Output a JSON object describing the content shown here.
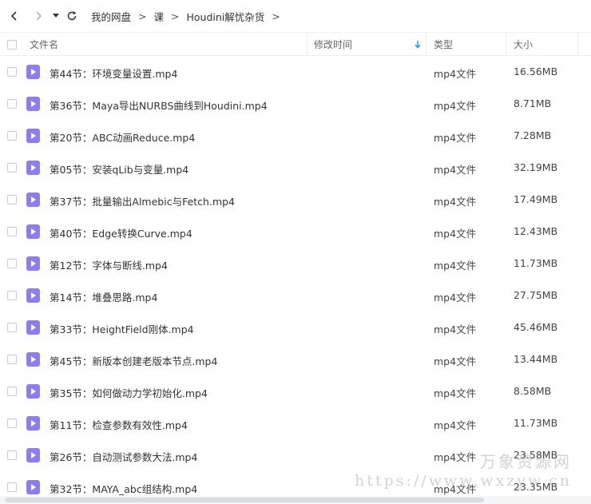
{
  "breadcrumb": [
    "我的网盘",
    "课",
    "Houdini解忧杂货"
  ],
  "breadcrumb_separator": ">",
  "columns": {
    "name": "文件名",
    "modified": "修改时间",
    "type": "类型",
    "size": "大小"
  },
  "files": [
    {
      "name": "第44节：环境变量设置.mp4",
      "type": "mp4文件",
      "size": "16.56MB"
    },
    {
      "name": "第36节：Maya导出NURBS曲线到Houdini.mp4",
      "type": "mp4文件",
      "size": "8.71MB"
    },
    {
      "name": "第20节：ABC动画Reduce.mp4",
      "type": "mp4文件",
      "size": "7.28MB"
    },
    {
      "name": "第05节：安装qLib与变量.mp4",
      "type": "mp4文件",
      "size": "32.19MB"
    },
    {
      "name": "第37节：批量输出Almebic与Fetch.mp4",
      "type": "mp4文件",
      "size": "17.49MB"
    },
    {
      "name": "第40节：Edge转换Curve.mp4",
      "type": "mp4文件",
      "size": "12.43MB"
    },
    {
      "name": "第12节：字体与断线.mp4",
      "type": "mp4文件",
      "size": "11.73MB"
    },
    {
      "name": "第14节：堆叠思路.mp4",
      "type": "mp4文件",
      "size": "27.75MB"
    },
    {
      "name": "第33节：HeightField刚体.mp4",
      "type": "mp4文件",
      "size": "45.46MB"
    },
    {
      "name": "第45节：新版本创建老版本节点.mp4",
      "type": "mp4文件",
      "size": "13.44MB"
    },
    {
      "name": "第35节：如何做动力学初始化.mp4",
      "type": "mp4文件",
      "size": "8.58MB"
    },
    {
      "name": "第11节：检查参数有效性.mp4",
      "type": "mp4文件",
      "size": "11.73MB"
    },
    {
      "name": "第26节：自动测试参数大法.mp4",
      "type": "mp4文件",
      "size": "23.58MB"
    },
    {
      "name": "第32节：MAYA_abc组结构.mp4",
      "type": "mp4文件",
      "size": "23.35MB"
    }
  ],
  "watermark": {
    "line1": "万象资源网",
    "line2": "https://www.wxzyw.cn"
  },
  "colors": {
    "file_icon": "#8b7ff0",
    "sort_arrow": "#2a8cff"
  }
}
